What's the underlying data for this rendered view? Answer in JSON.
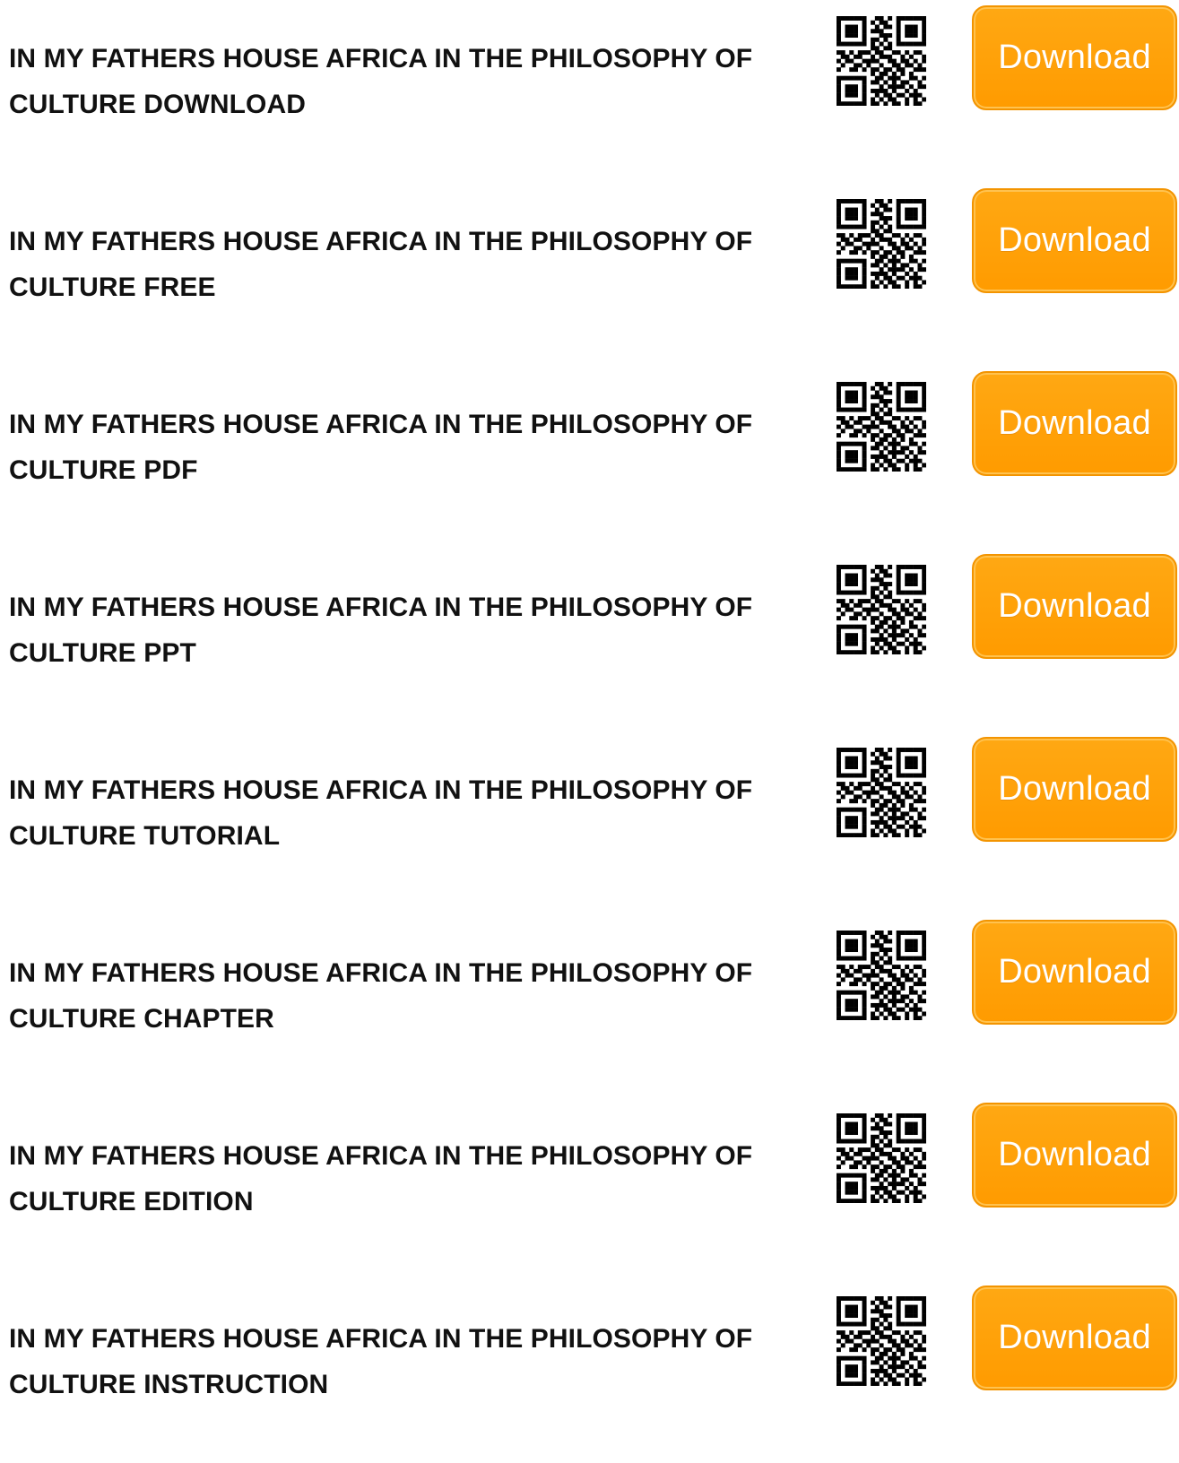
{
  "items": [
    {
      "title": "IN MY FATHERS HOUSE AFRICA IN THE PHILOSOPHY OF CULTURE DOWNLOAD",
      "button": "Download",
      "icon": "qr-code-icon"
    },
    {
      "title": "IN MY FATHERS HOUSE AFRICA IN THE PHILOSOPHY OF CULTURE FREE",
      "button": "Download",
      "icon": "qr-code-icon"
    },
    {
      "title": "IN MY FATHERS HOUSE AFRICA IN THE PHILOSOPHY OF CULTURE PDF",
      "button": "Download",
      "icon": "qr-code-icon"
    },
    {
      "title": "IN MY FATHERS HOUSE AFRICA IN THE PHILOSOPHY OF CULTURE PPT",
      "button": "Download",
      "icon": "qr-code-icon"
    },
    {
      "title": "IN MY FATHERS HOUSE AFRICA IN THE PHILOSOPHY OF CULTURE TUTORIAL",
      "button": "Download",
      "icon": "qr-code-icon"
    },
    {
      "title": "IN MY FATHERS HOUSE AFRICA IN THE PHILOSOPHY OF CULTURE CHAPTER",
      "button": "Download",
      "icon": "qr-code-icon"
    },
    {
      "title": "IN MY FATHERS HOUSE AFRICA IN THE PHILOSOPHY OF CULTURE EDITION",
      "button": "Download",
      "icon": "qr-code-icon"
    },
    {
      "title": "IN MY FATHERS HOUSE AFRICA IN THE PHILOSOPHY OF CULTURE INSTRUCTION",
      "button": "Download",
      "icon": "qr-code-icon"
    }
  ],
  "colors": {
    "button_bg": "#ff9f0a",
    "button_border": "#f39400",
    "button_text": "#ffffff",
    "title_text": "#111111"
  }
}
